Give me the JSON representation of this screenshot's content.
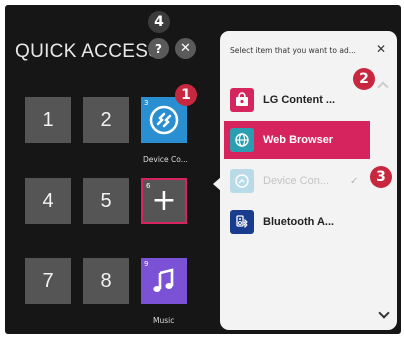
{
  "quick_access": {
    "title": "QUICK ACCESS",
    "help_label": "?",
    "close_label": "✕",
    "tiles": [
      {
        "label": "1"
      },
      {
        "label": "2"
      },
      {
        "index": "3",
        "caption": "Device Co..."
      },
      {
        "label": "4"
      },
      {
        "label": "5"
      },
      {
        "index": "6",
        "symbol": "+"
      },
      {
        "label": "7"
      },
      {
        "label": "8"
      },
      {
        "index": "9",
        "caption": "Music"
      }
    ]
  },
  "callouts": [
    "1",
    "2",
    "3",
    "4"
  ],
  "panel": {
    "heading": "Select item that you want to ad...",
    "close_label": "✕",
    "items": [
      {
        "label": "LG Content ...",
        "icon": "lg-content-store-icon",
        "color": "#d6245e"
      },
      {
        "label": "Web Browser",
        "icon": "globe-icon",
        "color": "#2b9fb1"
      },
      {
        "label": "Device Con...",
        "icon": "device-connector-icon",
        "color": "#b9dbe8"
      },
      {
        "label": "Bluetooth A...",
        "icon": "bluetooth-device-icon",
        "color": "#1a3c8f"
      }
    ],
    "check_label": "✓"
  },
  "colors": {
    "accent": "#d6245e",
    "callout": "#c8283f",
    "tile": "#555555",
    "background": "#161616"
  }
}
